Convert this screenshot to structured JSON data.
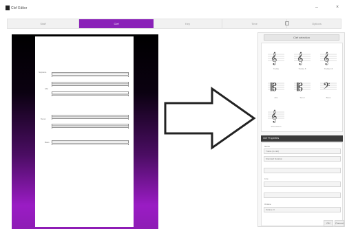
{
  "window": {
    "title": "Clef Editor"
  },
  "tabs": [
    {
      "label": "Staff"
    },
    {
      "label": "Clef"
    },
    {
      "label": "Key"
    },
    {
      "label": "Time"
    },
    {
      "label": "Options"
    }
  ],
  "score": {
    "staff_labels": [
      "Soprano",
      "Alto",
      "Tenor",
      "Bass"
    ]
  },
  "panel": {
    "dropdown": "Clef selection",
    "clefs": [
      {
        "label": "Treble"
      },
      {
        "label": "Treble 8"
      },
      {
        "label": "Treble 15"
      },
      {
        "label": "Alto"
      },
      {
        "label": "Tenor"
      },
      {
        "label": "Bass"
      },
      {
        "label": "Percussion"
      }
    ],
    "section_header": "Clef Properties",
    "fields": [
      {
        "label": "Name",
        "value": "Treble (G clef)"
      },
      {
        "label": "",
        "value": "Standard Notation"
      },
      {
        "label": "",
        "value": ""
      },
      {
        "label": "Line",
        "value": ""
      },
      {
        "label": "",
        "value": ""
      },
      {
        "label": "Octave",
        "value": "Octave: 0"
      }
    ]
  },
  "buttons": {
    "ok": "OK",
    "cancel": "Cancel"
  },
  "colors": {
    "accent": "#8a21b8",
    "preview_bottom": "#9a1cc4"
  }
}
